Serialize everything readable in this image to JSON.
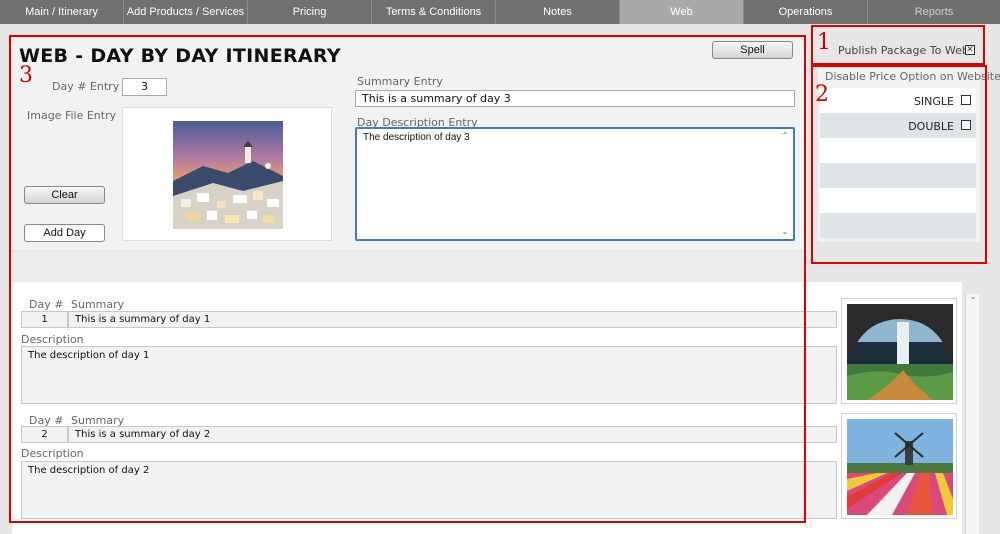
{
  "tabs": [
    {
      "label": "Main / Itinerary"
    },
    {
      "label": "Add Products / Services"
    },
    {
      "label": "Pricing"
    },
    {
      "label": "Terms & Conditions"
    },
    {
      "label": "Notes"
    },
    {
      "label": "Web",
      "active": true
    },
    {
      "label": "Operations"
    },
    {
      "label": "Reports"
    }
  ],
  "annotations": [
    "1",
    "2",
    "3"
  ],
  "entry": {
    "title": "WEB - DAY BY DAY ITINERARY",
    "spell_label": "Spell",
    "day_label": "Day # Entry",
    "day_value": "3",
    "image_label": "Image File Entry",
    "clear_label": "Clear",
    "add_day_label": "Add Day",
    "summary_label": "Summary Entry",
    "summary_value": "This is a summary of day 3",
    "description_label": "Day Description Entry",
    "description_value": "The description of day 3"
  },
  "publish": {
    "label": "Publish Package To Web?",
    "checked": true
  },
  "price_options": {
    "title": "Disable Price Option on Website",
    "options": [
      {
        "label": "SINGLE",
        "checked": false
      },
      {
        "label": "DOUBLE",
        "checked": false
      }
    ]
  },
  "days": [
    {
      "day_header": "Day #",
      "summary_header": "Summary",
      "description_header": "Description",
      "day": "1",
      "summary": "This is a summary of day 1",
      "description": "The description of day 1"
    },
    {
      "day_header": "Day #",
      "summary_header": "Summary",
      "description_header": "Description",
      "day": "2",
      "summary": "This is a summary of day 2",
      "description": "The description of day 2"
    }
  ],
  "colors": {
    "annotation": "#e00000",
    "active_tab": "#a9a9a9",
    "focus_border": "#4a79b8"
  },
  "icons": {
    "scroll_up": "chevron-up-icon",
    "scroll_down": "chevron-down-icon",
    "checkbox_checked": "checkbox-checked-icon"
  }
}
